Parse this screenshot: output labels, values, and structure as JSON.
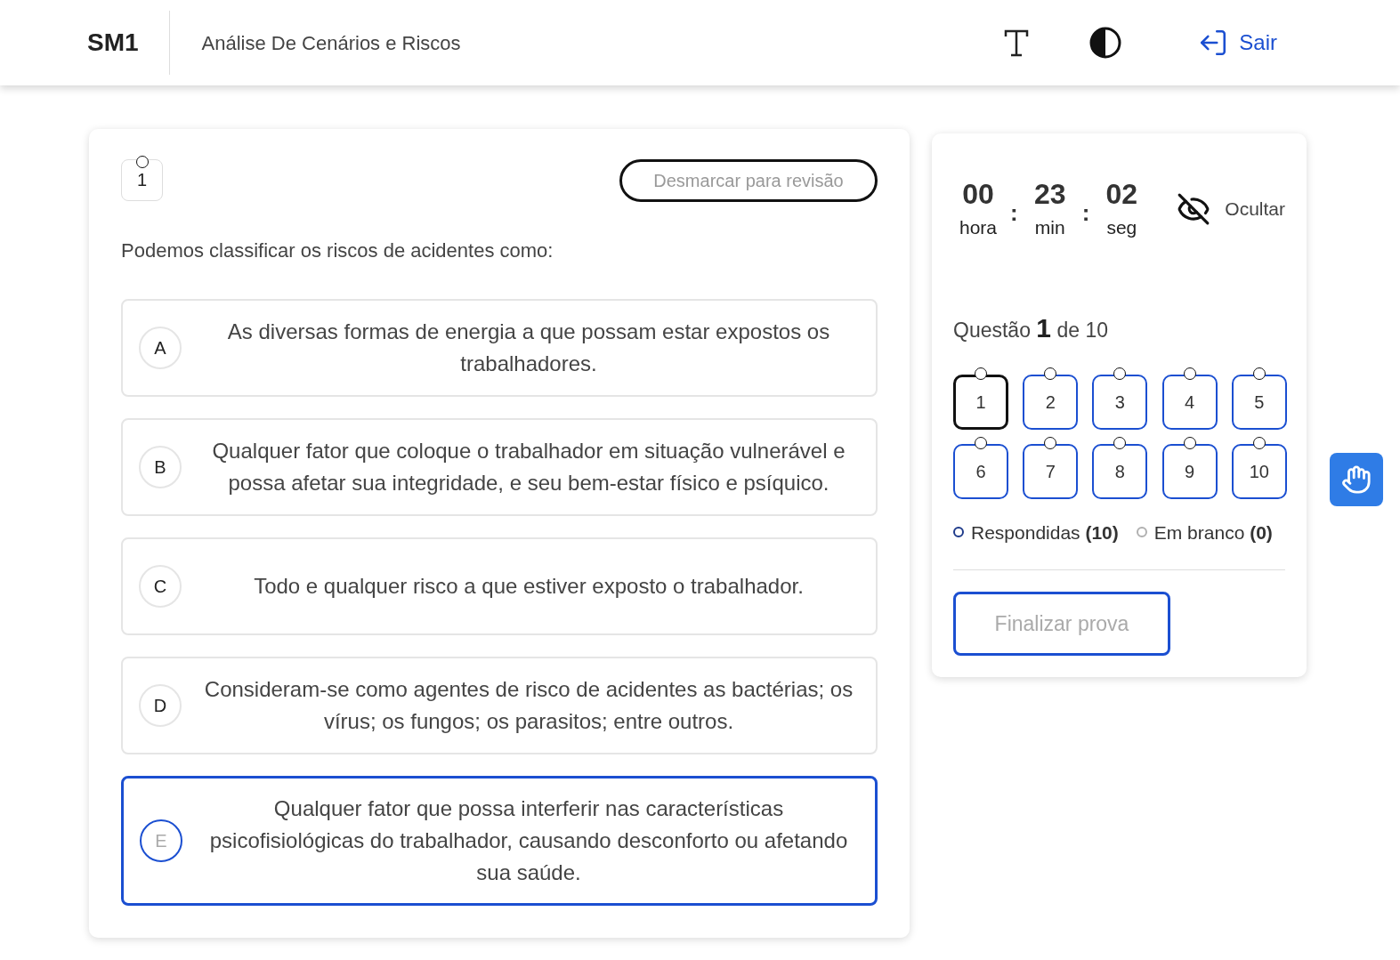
{
  "header": {
    "logo": "SM1",
    "title": "Análise De Cenários e Riscos",
    "logout": "Sair"
  },
  "question": {
    "number": "1",
    "review_button": "Desmarcar para revisão",
    "statement": "Podemos classificar os riscos de acidentes como:",
    "options": [
      {
        "letter": "A",
        "text": "As diversas formas de energia a que possam estar expostos os trabalhadores.",
        "selected": false
      },
      {
        "letter": "B",
        "text": "Qualquer fator que coloque o trabalhador em situação vulnerável e possa afetar sua integridade, e seu bem-estar físico e psíquico.",
        "selected": false
      },
      {
        "letter": "C",
        "text": "Todo e qualquer risco a que estiver exposto o trabalhador.",
        "selected": false
      },
      {
        "letter": "D",
        "text": "Consideram-se como agentes de risco de acidentes as bactérias; os vírus; os fungos; os parasitos; entre outros.",
        "selected": false
      },
      {
        "letter": "E",
        "text": "Qualquer fator que possa interferir nas características psicofisiológicas do trabalhador, causando desconforto ou afetando sua saúde.",
        "selected": true
      }
    ]
  },
  "timer": {
    "units": [
      {
        "value": "00",
        "label": "hora"
      },
      {
        "value": "23",
        "label": "min"
      },
      {
        "value": "02",
        "label": "seg"
      }
    ],
    "separator": ":",
    "hide": "Ocultar"
  },
  "progress": {
    "text": "Questão **1** de 10",
    "questions": [
      {
        "label": "1",
        "selected": true,
        "answered": true
      },
      {
        "label": "2",
        "selected": false,
        "answered": true
      },
      {
        "label": "3",
        "selected": false,
        "answered": true
      },
      {
        "label": "4",
        "selected": false,
        "answered": true
      },
      {
        "label": "5",
        "selected": false,
        "answered": true
      },
      {
        "label": "6",
        "selected": false,
        "answered": true
      },
      {
        "label": "7",
        "selected": false,
        "answered": true
      },
      {
        "label": "8",
        "selected": false,
        "answered": true
      },
      {
        "label": "9",
        "selected": false,
        "answered": true
      },
      {
        "label": "10",
        "selected": false,
        "answered": true
      }
    ],
    "legend": [
      {
        "text": "Respondidas **(10)**",
        "color": "#1e3a8a"
      },
      {
        "text": "Em branco **(0)**",
        "color": "#b0b0b0"
      }
    ],
    "finish": "Finalizar prova"
  }
}
